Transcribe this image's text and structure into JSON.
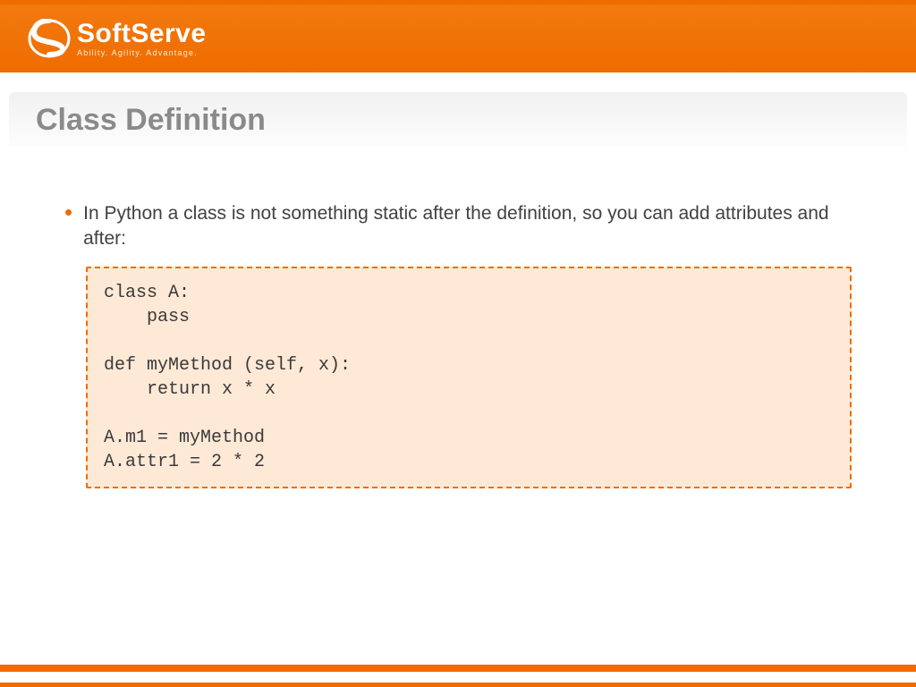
{
  "brand": {
    "name": "SoftServe",
    "tagline": "Ability. Agility. Advantage."
  },
  "title": "Class Definition",
  "bullet": "In Python a class is not something static after the definition, so you can add attributes and after:",
  "code": "class A:\n    pass\n\ndef myMethod (self, x):\n    return x * x\n\nA.m1 = myMethod\nA.attr1 = 2 * 2",
  "colors": {
    "accent": "#ef6c00",
    "code_bg": "#fde9d6",
    "title_gray": "#8a8a8a"
  }
}
